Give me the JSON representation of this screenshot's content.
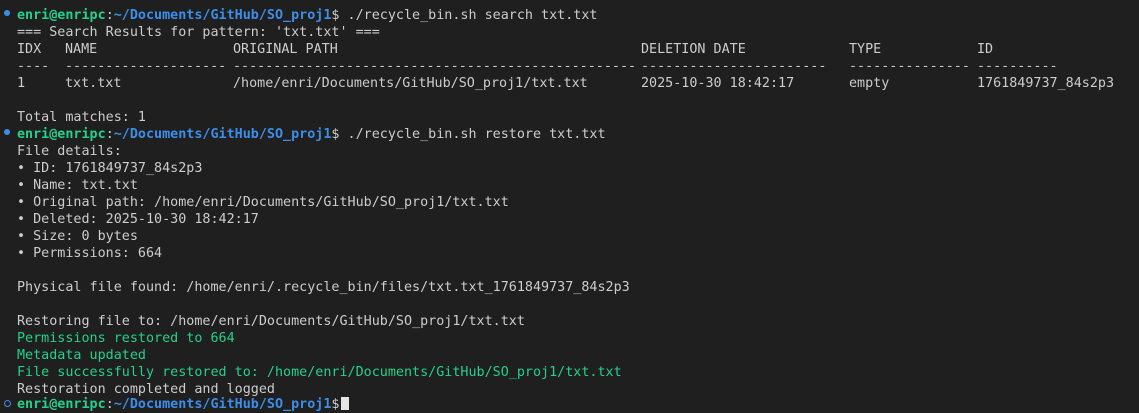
{
  "prompt1": {
    "user": "enri@enripc",
    "path": "~/Documents/GitHub/SO_proj1",
    "command": " ./recycle_bin.sh search txt.txt"
  },
  "search_header": "=== Search Results for pattern: 'txt.txt' ===",
  "table": {
    "headers": [
      "IDX",
      "NAME",
      "ORIGINAL PATH",
      "DELETION DATE",
      "TYPE",
      "ID"
    ],
    "separators": [
      "----",
      "--------------------",
      "--------------------------------------------------",
      "-----------------------",
      "---------------",
      "----------"
    ],
    "rows": [
      [
        "1",
        "txt.txt",
        "/home/enri/Documents/GitHub/SO_proj1/txt.txt",
        "2025-10-30 18:42:17",
        "empty",
        "1761849737_84s2p3"
      ]
    ]
  },
  "total_matches": "Total matches: 1",
  "prompt2": {
    "user": "enri@enripc",
    "path": "~/Documents/GitHub/SO_proj1",
    "command": " ./recycle_bin.sh restore txt.txt"
  },
  "details": {
    "title": "File details:",
    "items": [
      "• ID: 1761849737_84s2p3",
      "• Name: txt.txt",
      "• Original path: /home/enri/Documents/GitHub/SO_proj1/txt.txt",
      "• Deleted: 2025-10-30 18:42:17",
      "• Size: 0 bytes",
      "• Permissions: 664"
    ]
  },
  "physical_file": "Physical file found: /home/enri/.recycle_bin/files/txt.txt_1761849737_84s2p3",
  "restoring": "Restoring file to: /home/enri/Documents/GitHub/SO_proj1/txt.txt",
  "success_lines": [
    "Permissions restored to 664",
    "Metadata updated",
    "File successfully restored to: /home/enri/Documents/GitHub/SO_proj1/txt.txt"
  ],
  "completed": "Restoration completed and logged",
  "prompt3": {
    "user": "enri@enripc",
    "path": "~/Documents/GitHub/SO_proj1"
  },
  "colors": {
    "background": "#1f1f1f",
    "text": "#cccccc",
    "user_green": "#23d18b",
    "path_blue": "#3b8eea",
    "success_green": "#23d18b"
  }
}
